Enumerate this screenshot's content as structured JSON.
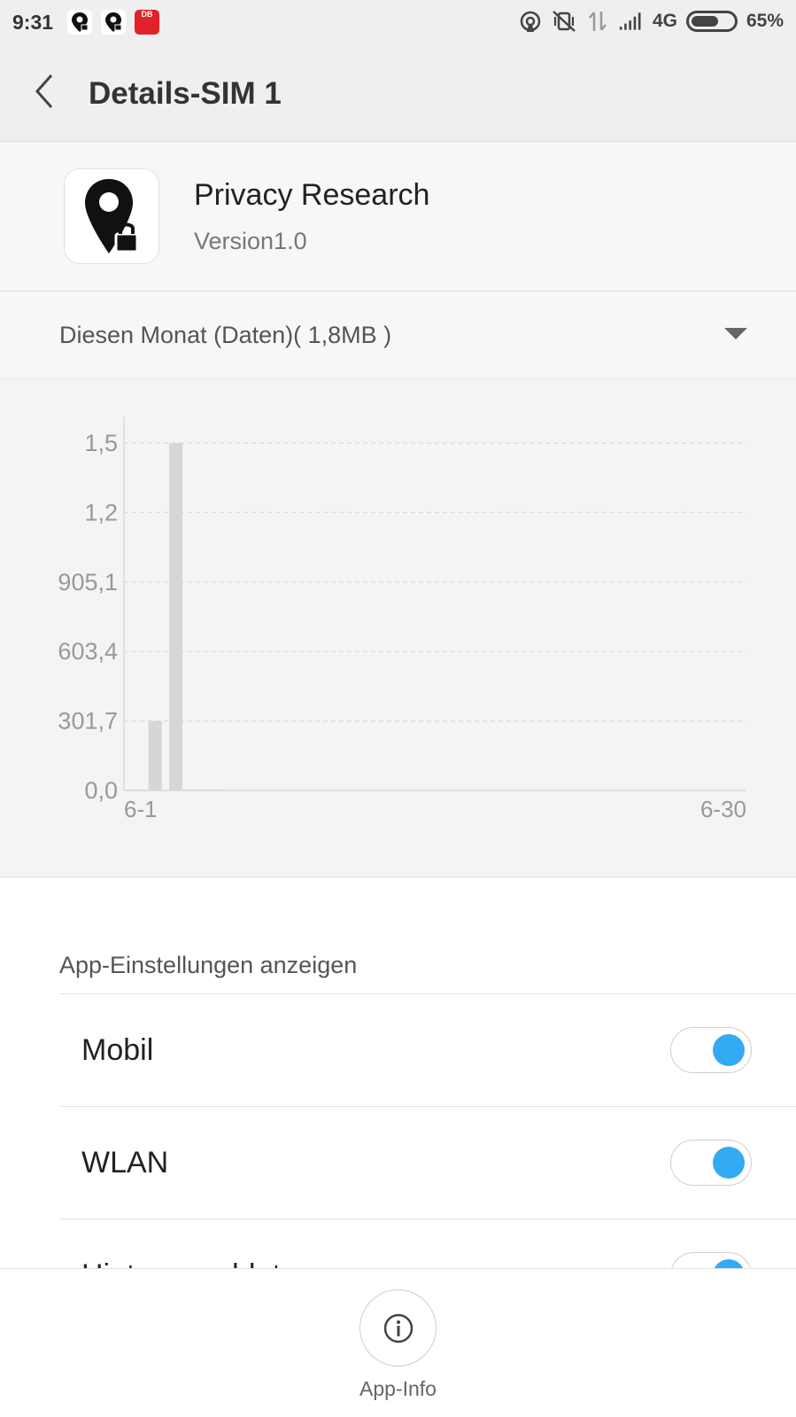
{
  "status_bar": {
    "time": "9:31",
    "network": "4G",
    "battery_percent": "65%",
    "battery_level": 0.65,
    "left_icons": [
      "privacy-research-notification-icon",
      "privacy-research-notification-icon",
      "db-app-notification-icon"
    ],
    "db_badge": "DB",
    "right_icons": [
      "hotspot-icon",
      "vibrate-off-icon",
      "data-transfer-icon",
      "signal-icon",
      "battery-icon"
    ]
  },
  "header": {
    "title": "Details-SIM 1",
    "back_icon": "chevron-left-icon"
  },
  "app": {
    "name": "Privacy Research",
    "version": "Version1.0",
    "icon": "location-pin-lock-icon"
  },
  "period": {
    "label": "Diesen Monat (Daten)( 1,8MB )",
    "dropdown_icon": "triangle-down-icon"
  },
  "chart_data": {
    "type": "bar",
    "y_ticks": [
      "0,0",
      "301,7",
      "603,4",
      "905,1",
      "1,2",
      "1,5"
    ],
    "ylim": [
      0,
      1508.5
    ],
    "x_start_label": "6-1",
    "x_end_label": "6-30",
    "days": 30,
    "x": [
      1,
      2,
      3,
      4,
      5
    ],
    "values": [
      2,
      301.7,
      1508.5,
      0,
      3
    ],
    "bar_color": "#d6d6d6",
    "grid": true
  },
  "settings": {
    "section_title": "App-Einstellungen anzeigen",
    "rows": [
      {
        "label": "Mobil",
        "enabled": true
      },
      {
        "label": "WLAN",
        "enabled": true
      },
      {
        "label": "Hintergrunddaten",
        "enabled": true
      }
    ]
  },
  "bottom": {
    "app_info_label": "App-Info",
    "app_info_icon": "info-icon"
  },
  "colors": {
    "accent": "#33aaf4",
    "db_red": "#e2212a"
  }
}
